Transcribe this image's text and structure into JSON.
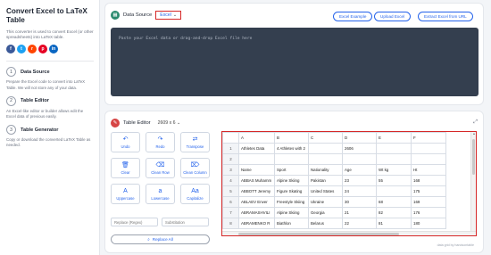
{
  "sidebar": {
    "title": "Convert Excel to LaTeX Table",
    "description": "This converter is used to convert Excel (or other spreadsheets) into LaTeX table.",
    "social": [
      {
        "name": "facebook-icon",
        "glyph": "f",
        "color": "#3b5998"
      },
      {
        "name": "twitter-icon",
        "glyph": "t",
        "color": "#1da1f2"
      },
      {
        "name": "reddit-icon",
        "glyph": "r",
        "color": "#ff4500"
      },
      {
        "name": "pinterest-icon",
        "glyph": "p",
        "color": "#e60023"
      },
      {
        "name": "linkedin-icon",
        "glyph": "in",
        "color": "#0a66c2"
      }
    ],
    "steps": [
      {
        "num": "1",
        "title": "Data Source",
        "desc": "Prepare the Excel code to convert into LaTeX Table. We will not store any of your data."
      },
      {
        "num": "2",
        "title": "Table Editor",
        "desc": "An Excel-like editor or builder allows edit the Excel data of previous easily."
      },
      {
        "num": "3",
        "title": "Table Generator",
        "desc": "Copy or download the converted LaTeX Table as needed."
      }
    ]
  },
  "data_source": {
    "title": "Data Source",
    "format": "Excel",
    "buttons": [
      "Excel Example",
      "Upload Excel",
      "Extract Excel from URL"
    ],
    "placeholder": "Paste your Excel data or drag-and-drop Excel file here"
  },
  "table_editor": {
    "title": "Table Editor",
    "size": "2609 x 6",
    "tools": [
      {
        "name": "undo-button",
        "icon": "↶",
        "label": "Undo"
      },
      {
        "name": "redo-button",
        "icon": "↷",
        "label": "Redo"
      },
      {
        "name": "transpose-button",
        "icon": "⇄",
        "label": "Transpose"
      },
      {
        "name": "clear-button",
        "icon": "🗑",
        "label": "Clear"
      },
      {
        "name": "clean-row-button",
        "icon": "⌫",
        "label": "Clean Row"
      },
      {
        "name": "clean-column-button",
        "icon": "⌦",
        "label": "Clean Column"
      },
      {
        "name": "uppercase-button",
        "icon": "A",
        "label": "Uppercase"
      },
      {
        "name": "lowercase-button",
        "icon": "a",
        "label": "Lowercase"
      },
      {
        "name": "capitalize-button",
        "icon": "Aa",
        "label": "Capitalize"
      }
    ],
    "replace_placeholder": "Replace (Regex)",
    "substitution_placeholder": "Substitution",
    "replace_all_label": "Replace All",
    "col_headers": [
      "",
      "A",
      "B",
      "C",
      "D",
      "E",
      "F"
    ],
    "rows": [
      [
        "1",
        "Athletes Data",
        "4 Athletes with 2",
        "",
        "2606",
        "",
        ""
      ],
      [
        "2",
        "",
        "",
        "",
        "",
        "",
        ""
      ],
      [
        "3",
        "Name",
        "Sport",
        "Nationality",
        "Age",
        "Wt kg",
        "Ht"
      ],
      [
        "4",
        "ABBAS Muhamm",
        "Alpine Skiing",
        "Pakistan",
        "23",
        "55",
        "168"
      ],
      [
        "5",
        "ABBOTT Jeremy",
        "Figure Skating",
        "United States",
        "24",
        "",
        "175"
      ],
      [
        "6",
        "ABLAEV Enver",
        "Freestyle Skiing",
        "Ukraine",
        "30",
        "68",
        "169"
      ],
      [
        "7",
        "ABRAMASHVILI",
        "Alpine Skiing",
        "Georgia",
        "21",
        "82",
        "176"
      ],
      [
        "8",
        "ABRAMENKO R",
        "Biathlon",
        "Belarus",
        "22",
        "81",
        "180"
      ]
    ],
    "credit": "data grid by handsontable"
  }
}
